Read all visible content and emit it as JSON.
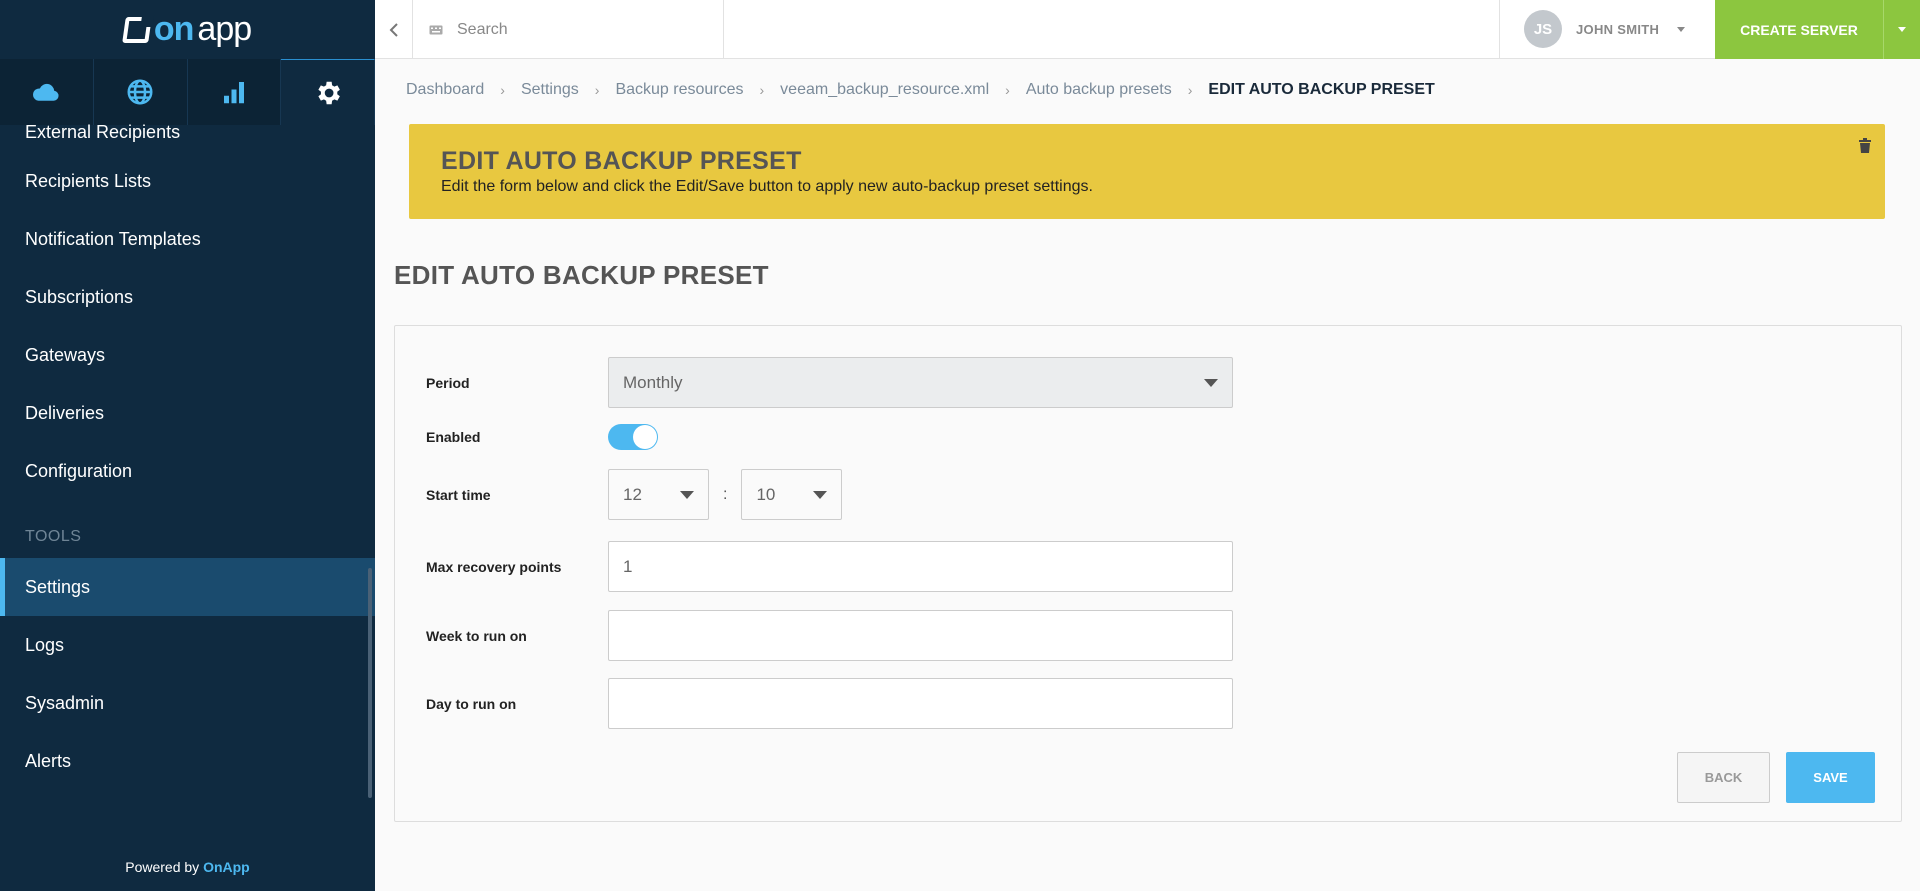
{
  "brand": {
    "logo_on": "on",
    "logo_app": "app"
  },
  "sidebar": {
    "items_top": [
      {
        "label": "External Recipients"
      },
      {
        "label": "Recipients Lists"
      },
      {
        "label": "Notification Templates"
      },
      {
        "label": "Subscriptions"
      },
      {
        "label": "Gateways"
      },
      {
        "label": "Deliveries"
      },
      {
        "label": "Configuration"
      }
    ],
    "section_tools": "TOOLS",
    "items_tools": [
      {
        "label": "Settings",
        "active": true
      },
      {
        "label": "Logs"
      },
      {
        "label": "Sysadmin"
      },
      {
        "label": "Alerts"
      }
    ],
    "powered_prefix": "Powered by",
    "powered_brand": "OnApp"
  },
  "topbar": {
    "search_placeholder": "Search",
    "user_initials": "JS",
    "user_name": "JOHN SMITH",
    "create_label": "CREATE SERVER"
  },
  "breadcrumb": {
    "items": [
      "Dashboard",
      "Settings",
      "Backup resources",
      "veeam_backup_resource.xml",
      "Auto backup presets"
    ],
    "current": "EDIT AUTO BACKUP PRESET"
  },
  "notice": {
    "title": "EDIT AUTO BACKUP PRESET",
    "text": "Edit the form below and click the Edit/Save button to apply new auto-backup preset settings."
  },
  "page_title": "EDIT AUTO BACKUP PRESET",
  "form": {
    "period_label": "Period",
    "period_value": "Monthly",
    "enabled_label": "Enabled",
    "enabled": true,
    "start_time_label": "Start time",
    "start_hour": "12",
    "start_colon": ":",
    "start_minute": "10",
    "max_recovery_label": "Max recovery points",
    "max_recovery_value": "1",
    "week_label": "Week to run on",
    "week_value": "",
    "day_label": "Day to run on",
    "day_value": ""
  },
  "buttons": {
    "back": "BACK",
    "save": "SAVE"
  },
  "colors": {
    "sidebar_bg": "#0f2a40",
    "accent": "#4db8f0",
    "notice_bg": "#e8c840",
    "create_bg": "#8cc63f"
  }
}
